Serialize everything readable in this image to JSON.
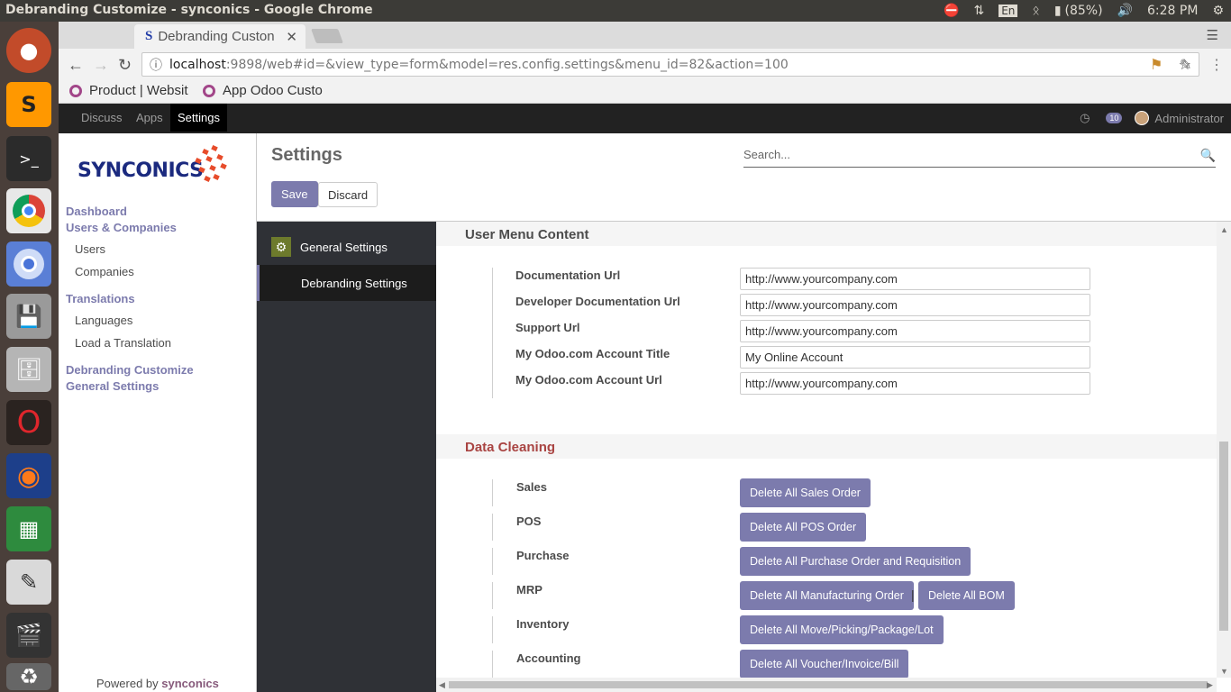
{
  "os": {
    "window_title": "Debranding Customize - synconics - Google Chrome",
    "tray": {
      "keyboard": "En",
      "battery": "(85%)",
      "time": "6:28 PM"
    }
  },
  "browser": {
    "tab_title": "Debranding Custon",
    "url_host": "localhost",
    "url_rest": ":9898/web#id=&view_type=form&model=res.config.settings&menu_id=82&action=100",
    "bookmarks": [
      "Product | Websit",
      "App Odoo Custo"
    ]
  },
  "odoo": {
    "menu": [
      "Discuss",
      "Apps",
      "Settings"
    ],
    "messages_count": "10",
    "user": "Administrator"
  },
  "left": {
    "sections": {
      "dashboard": "Dashboard",
      "users_companies": "Users & Companies",
      "users": "Users",
      "companies": "Companies",
      "translations": "Translations",
      "languages": "Languages",
      "load_translation": "Load a Translation",
      "debranding": "Debranding Customize",
      "general": "General Settings"
    },
    "logo_text": "SYNCONICS",
    "powered_prefix": "Powered by",
    "powered_brand": "synconics"
  },
  "control": {
    "title": "Settings",
    "search_placeholder": "Search...",
    "save": "Save",
    "discard": "Discard"
  },
  "settings_nav": {
    "general": "General Settings",
    "debranding": "Debranding Settings"
  },
  "user_menu": {
    "header": "User Menu Content",
    "fields": [
      {
        "label": "Documentation Url",
        "value": "http://www.yourcompany.com"
      },
      {
        "label": "Developer Documentation Url",
        "value": "http://www.yourcompany.com"
      },
      {
        "label": "Support Url",
        "value": "http://www.yourcompany.com"
      },
      {
        "label": "My Odoo.com Account Title",
        "value": "My Online Account"
      },
      {
        "label": "My Odoo.com Account Url",
        "value": "http://www.yourcompany.com"
      }
    ]
  },
  "data_cleaning": {
    "header": "Data Cleaning",
    "header_color": "#a94442",
    "rows": [
      {
        "label": "Sales",
        "buttons": [
          "Delete All Sales Order"
        ]
      },
      {
        "label": "POS",
        "buttons": [
          "Delete All POS Order"
        ]
      },
      {
        "label": "Purchase",
        "buttons": [
          "Delete All Purchase Order and Requisition"
        ]
      },
      {
        "label": "MRP",
        "buttons": [
          "Delete All Manufacturing Order",
          "Delete All BOM"
        ],
        "separator": "|"
      },
      {
        "label": "Inventory",
        "buttons": [
          "Delete All Move/Picking/Package/Lot"
        ]
      },
      {
        "label": "Accounting",
        "buttons": [
          "Delete All Voucher/Invoice/Bill"
        ]
      }
    ]
  },
  "colors": {
    "odoo_accent": "#7c7bad",
    "navbar": "#222222",
    "settings_sidebar": "#2f3136"
  }
}
